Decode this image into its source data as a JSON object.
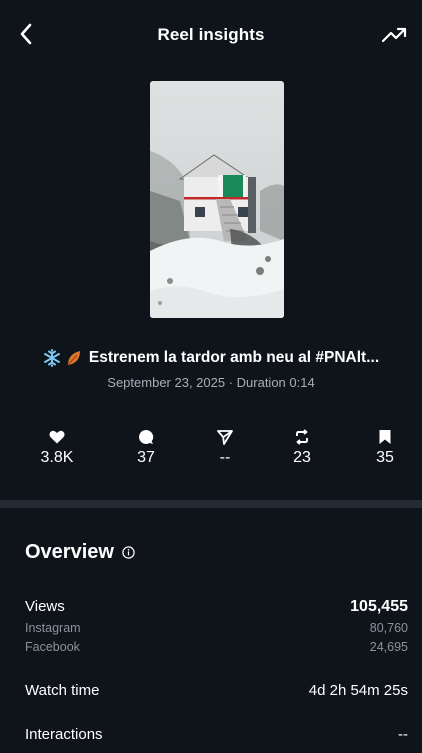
{
  "header": {
    "title": "Reel insights",
    "back_icon": "chevron-left-icon",
    "trend_icon": "trending-up-icon"
  },
  "reel": {
    "title": "Estrenem la tardor amb neu al #PNAlt...",
    "emojis": [
      "snowflake-icon",
      "leaf-icon"
    ],
    "subtitle": "September 23, 2025 · Duration 0:14"
  },
  "stats": [
    {
      "icon": "heart-icon",
      "value": "3.8K"
    },
    {
      "icon": "comment-icon",
      "value": "37"
    },
    {
      "icon": "send-icon",
      "value": "--"
    },
    {
      "icon": "repost-icon",
      "value": "23"
    },
    {
      "icon": "bookmark-icon",
      "value": "35"
    }
  ],
  "overview": {
    "title": "Overview",
    "info_icon": "info-icon",
    "views": {
      "label": "Views",
      "value": "105,455"
    },
    "instagram": {
      "label": "Instagram",
      "value": "80,760"
    },
    "facebook": {
      "label": "Facebook",
      "value": "24,695"
    },
    "watch_time": {
      "label": "Watch time",
      "value": "4d 2h 54m 25s"
    },
    "interactions": {
      "label": "Interactions",
      "value": "--"
    }
  },
  "colors": {
    "background": "#0f131a",
    "divider": "#252a33",
    "secondary_text": "#a8adb6",
    "muted_text": "#8d929b"
  }
}
